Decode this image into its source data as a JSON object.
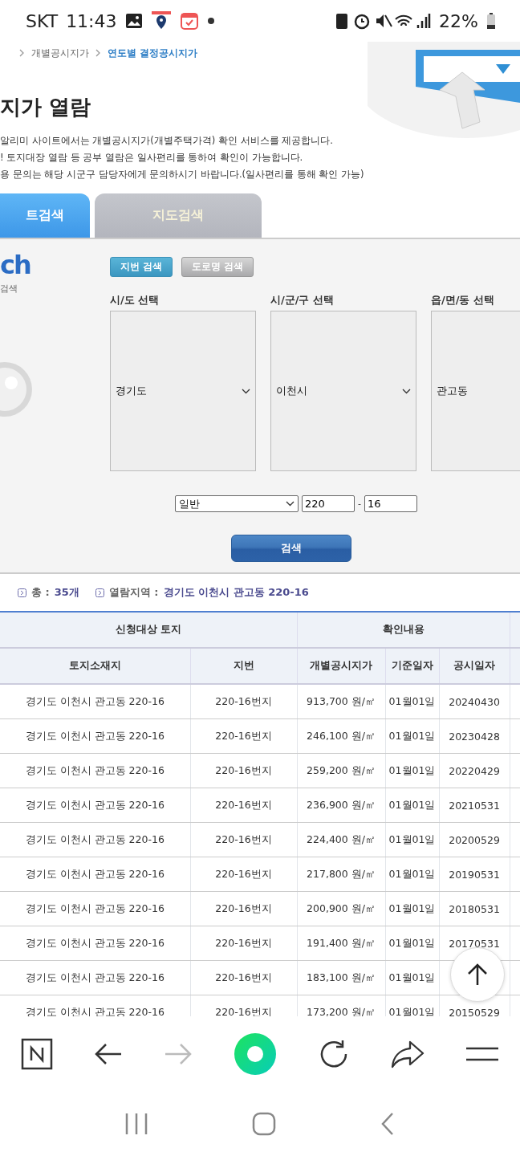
{
  "status_bar": {
    "carrier": "SKT",
    "time": "11:43",
    "battery": "22%"
  },
  "breadcrumb": [
    {
      "label": "개별공시지가",
      "current": false
    },
    {
      "label": "연도별 결정공시지가",
      "current": true
    }
  ],
  "title": "지가 열람",
  "notes": [
    "알리미 사이트에서는 개별공시지가(개별주택가격) 확인 서비스를 제공합니다.",
    "! 토지대장 열람 등 공부 열람은 일사편리를 통하여 확인이 가능합니다.",
    "용 문의는 해당 시군구 담당자에게 문의하시기 바랍니다.(일사편리를 통해 확인 가능)"
  ],
  "tabs": [
    {
      "label": "트검색",
      "selected": true
    },
    {
      "label": "지도검색",
      "selected": false
    }
  ],
  "search": {
    "logo_text": "ch",
    "logo_subtitle": "검색",
    "modes": [
      {
        "label": "지번 검색",
        "selected": true
      },
      {
        "label": "도로명 검색",
        "selected": false
      }
    ],
    "selectors": [
      {
        "label": "시/도 선택",
        "value": "경기도"
      },
      {
        "label": "시/군/구 선택",
        "value": "이천시"
      },
      {
        "label": "읍/면/동 선택",
        "value": "관고동"
      }
    ],
    "lot_type": "일반",
    "main_number": "220",
    "separator": "-",
    "sub_number": "16",
    "button": "검색"
  },
  "summary": {
    "total_label": "총 :",
    "total": "35개",
    "area_label": "열람지역 :",
    "area": "경기도 이천시 관고동 220-16"
  },
  "table": {
    "groups": [
      {
        "label": "신청대상 토지",
        "columns": [
          "토지소재지",
          "지번"
        ]
      },
      {
        "label": "확인내용",
        "columns": [
          "개별공시지가",
          "기준일자",
          "공시일자"
        ]
      }
    ],
    "rows": [
      {
        "location": "경기도 이천시 관고동 220-16",
        "lot": "220-16번지",
        "price": "913,700 원/㎡",
        "base_date": "01월01일",
        "notice_date": "20240430"
      },
      {
        "location": "경기도 이천시 관고동 220-16",
        "lot": "220-16번지",
        "price": "246,100 원/㎡",
        "base_date": "01월01일",
        "notice_date": "20230428"
      },
      {
        "location": "경기도 이천시 관고동 220-16",
        "lot": "220-16번지",
        "price": "259,200 원/㎡",
        "base_date": "01월01일",
        "notice_date": "20220429"
      },
      {
        "location": "경기도 이천시 관고동 220-16",
        "lot": "220-16번지",
        "price": "236,900 원/㎡",
        "base_date": "01월01일",
        "notice_date": "20210531"
      },
      {
        "location": "경기도 이천시 관고동 220-16",
        "lot": "220-16번지",
        "price": "224,400 원/㎡",
        "base_date": "01월01일",
        "notice_date": "20200529"
      },
      {
        "location": "경기도 이천시 관고동 220-16",
        "lot": "220-16번지",
        "price": "217,800 원/㎡",
        "base_date": "01월01일",
        "notice_date": "20190531"
      },
      {
        "location": "경기도 이천시 관고동 220-16",
        "lot": "220-16번지",
        "price": "200,900 원/㎡",
        "base_date": "01월01일",
        "notice_date": "20180531"
      },
      {
        "location": "경기도 이천시 관고동 220-16",
        "lot": "220-16번지",
        "price": "191,400 원/㎡",
        "base_date": "01월01일",
        "notice_date": "20170531"
      },
      {
        "location": "경기도 이천시 관고동 220-16",
        "lot": "220-16번지",
        "price": "183,100 원/㎡",
        "base_date": "01월01일"
      },
      {
        "location": "경기도 이천시 관고동 220-16",
        "lot": "220-16번지",
        "price": "173,200 원/㎡",
        "base_date": "01월01일",
        "notice_date": "20150529"
      }
    ]
  },
  "browser_toolbar": {
    "forward_disabled": true
  }
}
